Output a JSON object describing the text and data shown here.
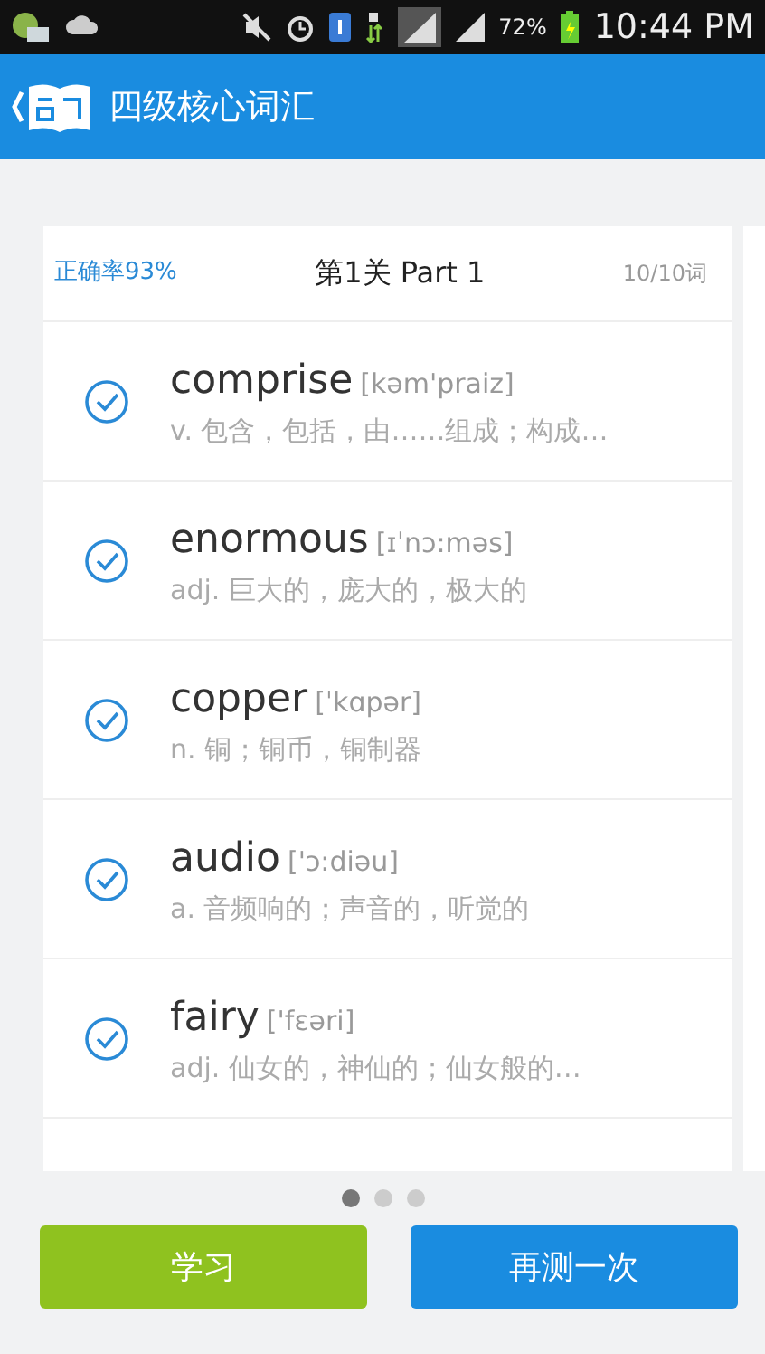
{
  "status_bar": {
    "battery_text": "72%",
    "time": "10:44 PM"
  },
  "app_bar": {
    "title": "四级核心词汇"
  },
  "card": {
    "accuracy": "正确率93%",
    "title": "第1关  Part 1",
    "count": "10/10词",
    "words": [
      {
        "word": "comprise",
        "phonetic": "[kəm'praiz]",
        "meaning": "v. 包含，包括，由……组成；构成…",
        "checked": true
      },
      {
        "word": "enormous",
        "phonetic": "[ɪˈnɔ:məs]",
        "meaning": "adj. 巨大的，庞大的，极大的",
        "checked": true
      },
      {
        "word": "copper",
        "phonetic": "[ˈkɑpər]",
        "meaning": "n. 铜；铜币，铜制器",
        "checked": true
      },
      {
        "word": "audio",
        "phonetic": "['ɔ:diəu]",
        "meaning": "a. 音频响的；声音的，听觉的",
        "checked": true
      },
      {
        "word": "fairy",
        "phonetic": "['fɛəri]",
        "meaning": "adj. 仙女的，神仙的；仙女般的…",
        "checked": true
      }
    ]
  },
  "pages": [
    {
      "selected": true
    },
    {
      "selected": false
    },
    {
      "selected": false
    }
  ],
  "buttons": [
    {
      "label": "学习",
      "kind": "study"
    },
    {
      "label": "再测一次",
      "kind": "retest"
    }
  ]
}
